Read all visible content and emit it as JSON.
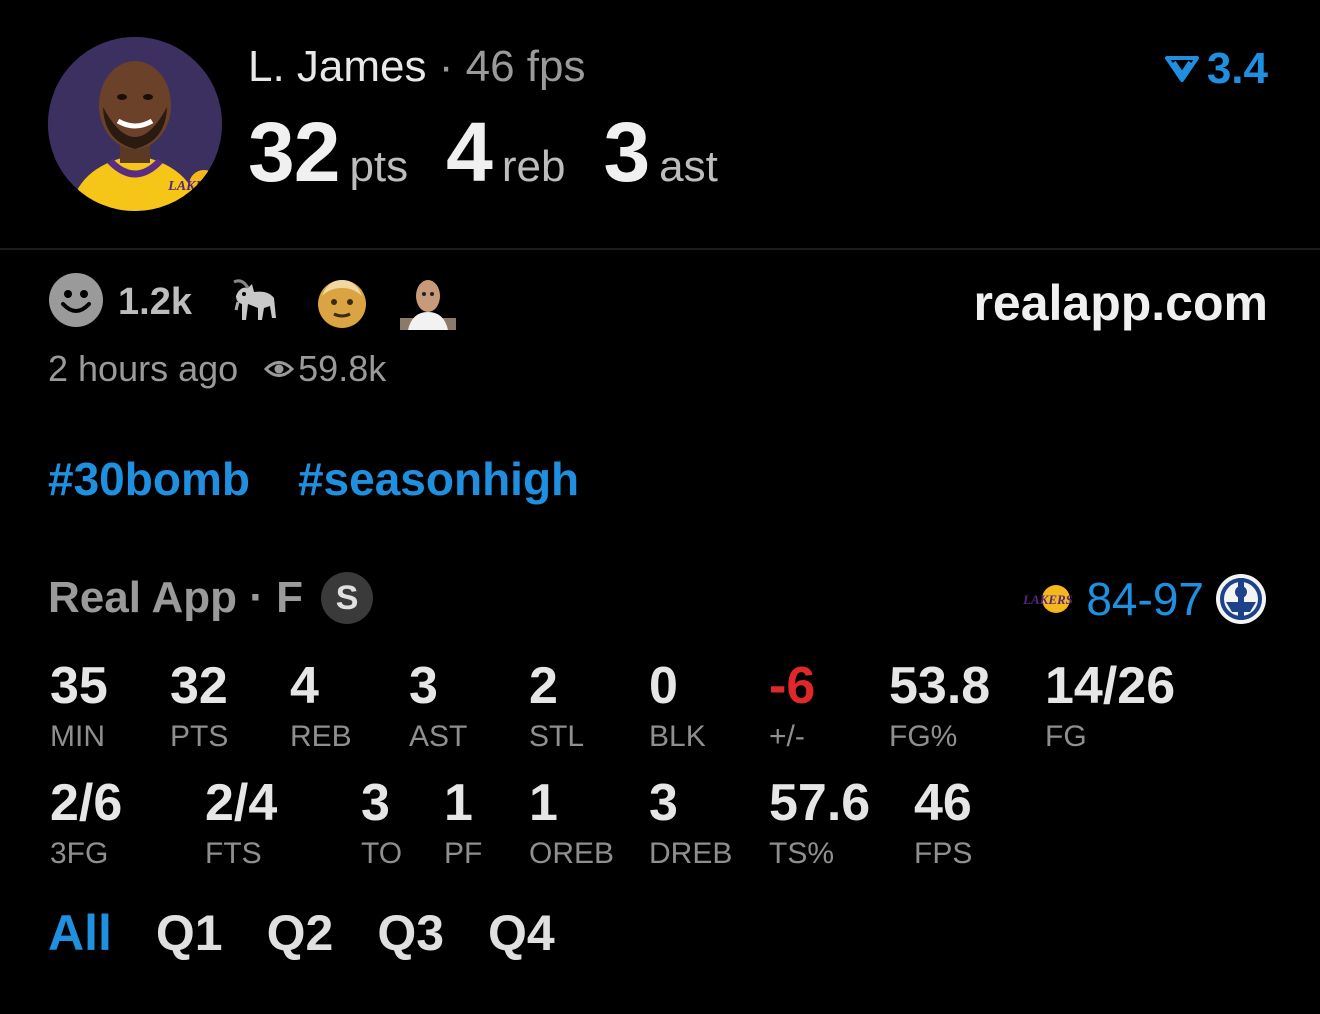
{
  "header": {
    "player_name": "L. James",
    "separator": "·",
    "fantasy_points": "46 fps",
    "points": "32",
    "points_unit": "pts",
    "rebounds": "4",
    "rebounds_unit": "reb",
    "assists": "3",
    "assists_unit": "ast",
    "rating": "3.4",
    "avatar_logo_icon": "lakers-logo-icon"
  },
  "social": {
    "reaction_count": "1.2k",
    "reaction_icons": [
      "smiley-icon",
      "goat-icon",
      "old-man-icon",
      "person-icon"
    ],
    "site": "realapp.com",
    "time_ago": "2 hours ago",
    "views": "59.8k"
  },
  "tags": [
    "#30bomb",
    "#seasonhigh"
  ],
  "game": {
    "source": "Real App · F",
    "badge": "S",
    "score": "84-97"
  },
  "stats": {
    "row1": [
      {
        "value": "35",
        "label": "MIN"
      },
      {
        "value": "32",
        "label": "PTS"
      },
      {
        "value": "4",
        "label": "REB"
      },
      {
        "value": "3",
        "label": "AST"
      },
      {
        "value": "2",
        "label": "STL"
      },
      {
        "value": "0",
        "label": "BLK"
      },
      {
        "value": "-6",
        "label": "+/-"
      },
      {
        "value": "53.8",
        "label": "FG%"
      },
      {
        "value": "14/26",
        "label": "FG"
      }
    ],
    "row2": [
      {
        "value": "2/6",
        "label": "3FG"
      },
      {
        "value": "2/4",
        "label": "FTS"
      },
      {
        "value": "3",
        "label": "TO"
      },
      {
        "value": "1",
        "label": "PF"
      },
      {
        "value": "1",
        "label": "OREB"
      },
      {
        "value": "3",
        "label": "DREB"
      },
      {
        "value": "57.6",
        "label": "TS%"
      },
      {
        "value": "46",
        "label": "FPS"
      }
    ]
  },
  "filters": [
    "All",
    "Q1",
    "Q2",
    "Q3",
    "Q4"
  ],
  "colors": {
    "accent": "#1f8fe0",
    "negative": "#e0272a",
    "background": "#000000"
  }
}
